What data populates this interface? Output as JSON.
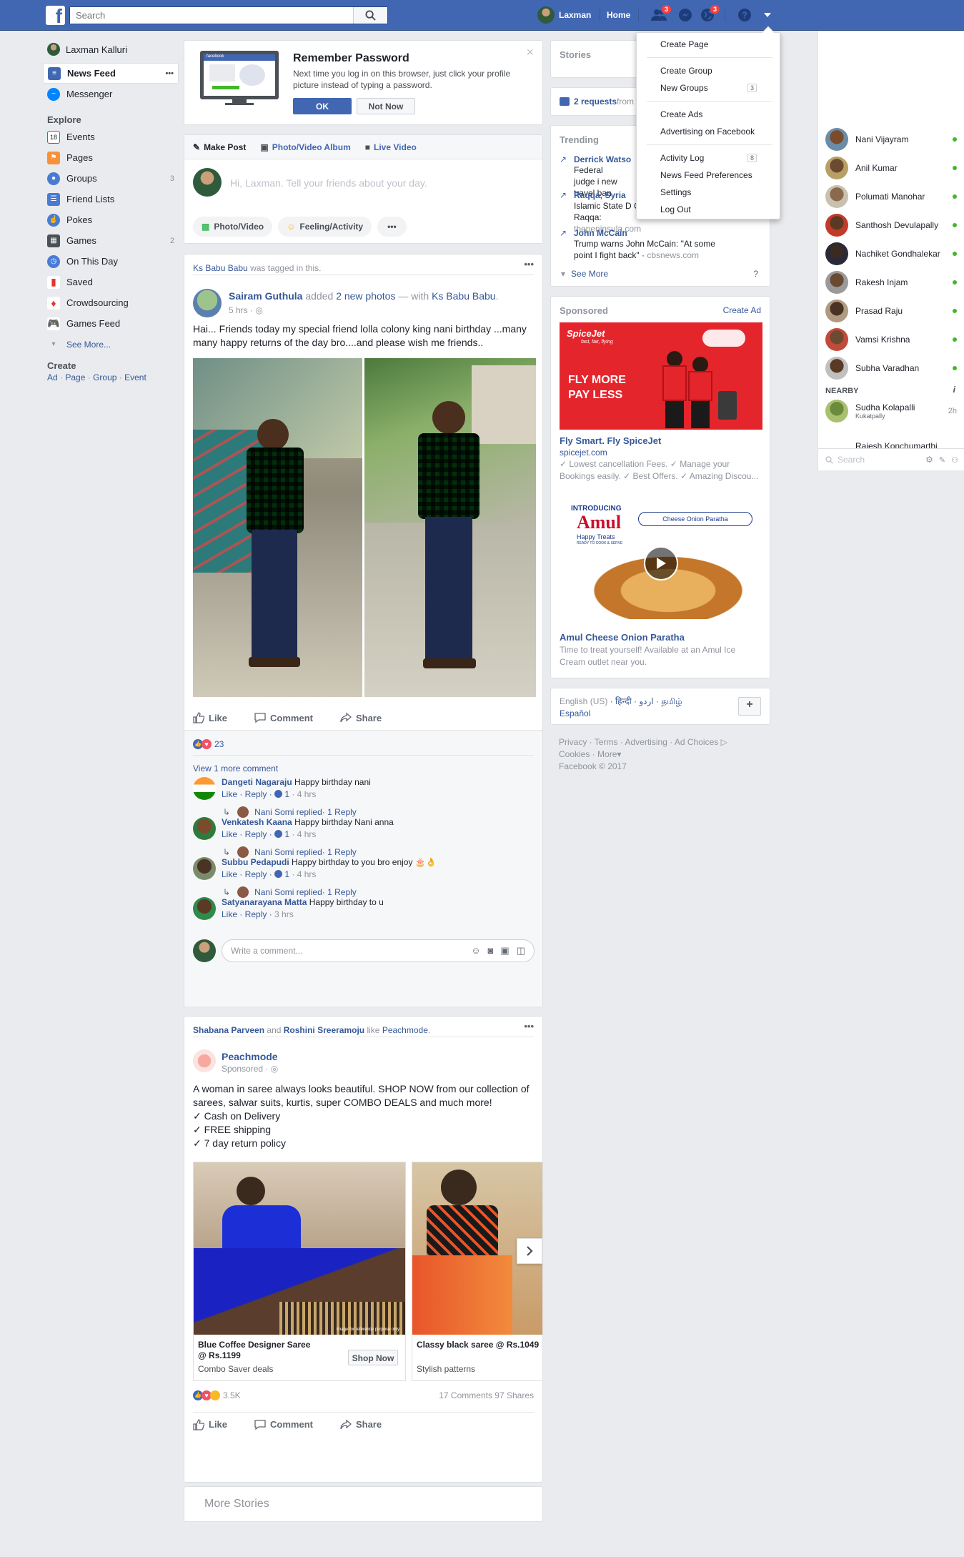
{
  "topbar": {
    "search_placeholder": "Search",
    "user_name": "Laxman",
    "home_label": "Home",
    "friend_requests_count": "3",
    "notifications_count": "3"
  },
  "dropdown_menu": {
    "items": [
      {
        "label": "Create Page"
      },
      {
        "label": "Create Group"
      },
      {
        "label": "New Groups",
        "count": "3"
      },
      {
        "label": "Create Ads"
      },
      {
        "label": "Advertising on Facebook"
      },
      {
        "label": "Activity Log",
        "count": "8"
      },
      {
        "label": "News Feed Preferences"
      },
      {
        "label": "Settings"
      },
      {
        "label": "Log Out"
      }
    ]
  },
  "left_nav": {
    "profile_name": "Laxman Kalluri",
    "news_feed": "News Feed",
    "news_feed_more": "•••",
    "messenger": "Messenger",
    "explore_heading": "Explore",
    "explore_items": [
      {
        "label": "Events",
        "count": ""
      },
      {
        "label": "Pages",
        "count": ""
      },
      {
        "label": "Groups",
        "count": "3"
      },
      {
        "label": "Friend Lists",
        "count": ""
      },
      {
        "label": "Pokes",
        "count": ""
      },
      {
        "label": "Games",
        "count": "2"
      },
      {
        "label": "On This Day",
        "count": ""
      },
      {
        "label": "Saved",
        "count": ""
      },
      {
        "label": "Crowdsourcing",
        "count": ""
      },
      {
        "label": "Games Feed",
        "count": ""
      }
    ],
    "events_icon_text": "18",
    "see_more": "See More...",
    "create_heading": "Create",
    "create_links": [
      "Ad",
      "Page",
      "Group",
      "Event"
    ]
  },
  "remember_password": {
    "title": "Remember Password",
    "body": "Next time you log in on this browser, just click your profile picture instead of typing a password.",
    "ok": "OK",
    "not_now": "Not Now",
    "monitor_brand": "facebook",
    "close": "×"
  },
  "composer": {
    "tabs": [
      "Make Post",
      "Photo/Video Album",
      "Live Video"
    ],
    "placeholder": "Hi, Laxman. Tell your friends about your day.",
    "buttons": [
      "Photo/Video",
      "Feeling/Activity",
      "•••"
    ]
  },
  "post1": {
    "tagged_by": "Ks Babu Babu",
    "tagged_suffix": " was tagged in this.",
    "author": "Sairam Guthula",
    "added_text": " added ",
    "photos_text": "2 new photos",
    "with_text": " — with ",
    "with_name": "Ks Babu Babu",
    "with_end": ".",
    "time": "5 hrs · ",
    "body": "Hai... Friends today my special friend lolla colony king nani birthday ...many many happy returns of the day bro....and please wish me friends..",
    "actions": [
      "Like",
      "Comment",
      "Share"
    ],
    "reaction_count": "23",
    "view_more": "View 1 more comment",
    "comments": [
      {
        "name": "Dangeti Nagaraju",
        "text": "Happy birthday nani",
        "actions": "Like · Reply · ",
        "likes": "1",
        "time": " · 4 hrs",
        "reply": "Nani Somi replied",
        "reply_count": " · 1 Reply"
      },
      {
        "name": "Venkatesh Kaana",
        "text": "Happy birthday Nani anna",
        "actions": "Like · Reply · ",
        "likes": "1",
        "time": " · 4 hrs",
        "reply": "Nani Somi replied",
        "reply_count": " · 1 Reply"
      },
      {
        "name": "Subbu Pedapudi",
        "text": "Happy birthday to you bro enjoy 🎂👌",
        "actions": "Like · Reply · ",
        "likes": "1",
        "time": " · 4 hrs",
        "reply": "Nani Somi replied",
        "reply_count": " · 1 Reply"
      },
      {
        "name": "Satyanarayana Matta",
        "text": "Happy birthday to u",
        "actions": "Like · Reply · ",
        "likes": "",
        "time": "3 hrs",
        "reply": "",
        "reply_count": ""
      }
    ],
    "write_comment": "Write a comment...",
    "more": "•••"
  },
  "post2": {
    "liker1": "Shabana Parveen",
    "and_text": " and ",
    "liker2": "Roshini Sreeramoju",
    "like_text": " like ",
    "page": "Peachmode",
    "page_end": ".",
    "author": "Peachmode",
    "sponsored": "Sponsored · ",
    "body_lines": [
      "A woman in saree always looks beautiful. SHOP NOW from our collection of sarees, salwar suits, kurtis, super COMBO DEALS and much more!",
      "✓ Cash on Delivery",
      "✓ FREE shipping",
      "✓ 7 day return policy"
    ],
    "carousel": [
      {
        "title": "Blue Coffee Designer Saree @ Rs.1199",
        "subtitle": "Combo Saver deals",
        "cta": "Shop Now"
      },
      {
        "title": "Classy black saree @ Rs.1049",
        "subtitle": "Stylish patterns",
        "cta": ""
      }
    ],
    "image_watermark": "Image for reference purpose only",
    "reaction_count": "3.5K",
    "comments_count": "17 Comments",
    "shares_count": "97 Shares",
    "actions": [
      "Like",
      "Comment",
      "Share"
    ],
    "more": "•••"
  },
  "more_stories": "More Stories",
  "right_col": {
    "stories": "Stories",
    "requests": "2 requests",
    "requests_suffix": " from",
    "trending_heading": "Trending",
    "trending": [
      {
        "title": "Derrick Watso",
        "desc": "Federal judge i new travel ban"
      },
      {
        "title": "Raqqa, Syria",
        "desc": "Islamic State D Capital Raqqa: ",
        "source": "thepeninsula.com"
      },
      {
        "title": "John McCain",
        "desc": "Trump warns John McCain: \"At some point I fight back\"",
        "source": "cbsnews.com"
      }
    ],
    "see_more": "See More",
    "help": "?",
    "sponsored_heading": "Sponsored",
    "create_ad": "Create Ad",
    "ad1": {
      "brand": "SpiceJet",
      "tagline": "fast, fair, flying",
      "banner": "FLY MORE PAY LESS",
      "title": "Fly Smart. Fly SpiceJet",
      "url": "spicejet.com",
      "desc": "✓ Lowest cancellation Fees. ✓ Manage your Bookings easily. ✓ Best Offers. ✓ Amazing Discou..."
    },
    "ad2": {
      "top": "INTRODUCING",
      "brand": "Amul",
      "sub": "Happy Treats",
      "small": "READY TO COOK & SERVE",
      "tag": "Cheese Onion Paratha",
      "title": "Amul Cheese Onion Paratha",
      "desc": "Time to treat yourself! Available at an Amul Ice Cream outlet near you."
    },
    "languages": [
      "English (US)",
      "हिन्दी",
      "اردو",
      "தமிழ்",
      "Español"
    ],
    "lang_add": "+",
    "footer_links": [
      "Privacy",
      "Terms",
      "Advertising",
      "Ad Choices",
      "Cookies",
      "More"
    ],
    "copyright": "Facebook © 2017"
  },
  "chat": {
    "contacts": [
      "Nani Vijayram",
      "Anil Kumar",
      "Polumati Manohar",
      "Santhosh Devulapally",
      "Nachiket Gondhalekar",
      "Rakesh Injam",
      "Prasad Raju",
      "Vamsi Krishna",
      "Subha Varadhan"
    ],
    "nearby_heading": "NEARBY",
    "nearby_info": "i",
    "nearby": [
      {
        "name": "Sudha Kolapalli",
        "location": "Kukatpally",
        "time": "2h"
      },
      {
        "name": "Rajesh Konchumarthi",
        "location": "",
        "time": ""
      }
    ],
    "search_placeholder": "Search"
  }
}
